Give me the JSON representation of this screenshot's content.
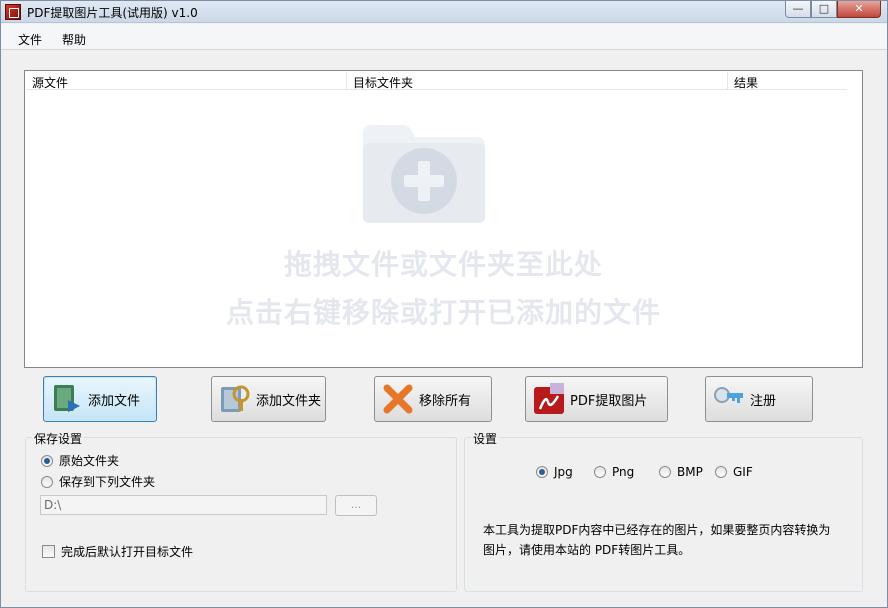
{
  "window": {
    "title": "PDF提取图片工具(试用版) v1.0",
    "controls": {
      "minimize": "—",
      "maximize": "□",
      "close": "✕"
    }
  },
  "menu": {
    "file": "文件",
    "help": "帮助"
  },
  "list": {
    "columns": {
      "source": "源文件",
      "target": "目标文件夹",
      "result": "结果"
    },
    "hint_line1": "拖拽文件或文件夹至此处",
    "hint_line2": "点击右键移除或打开已添加的文件"
  },
  "toolbar": {
    "add_file": "添加文件",
    "add_folder": "添加文件夹",
    "remove_all": "移除所有",
    "extract": "PDF提取图片",
    "register": "注册"
  },
  "save_settings": {
    "title": "保存设置",
    "option_original": "原始文件夹",
    "option_custom": "保存到下列文件夹",
    "selected": "original",
    "path": "D:\\",
    "browse_label": "...",
    "open_after": "完成后默认打开目标文件",
    "open_after_checked": false
  },
  "settings": {
    "title": "设置",
    "formats": [
      "Jpg",
      "Png",
      "BMP",
      "GIF"
    ],
    "selected_format": "Jpg",
    "description": "本工具为提取PDF内容中已经存在的图片，如果要整页内容转换为图片，请使用本站的 PDF转图片工具。"
  },
  "colors": {
    "accent": "#3c7fb1",
    "hint_text": "#e4e8ee",
    "close_red": "#c2473a"
  }
}
